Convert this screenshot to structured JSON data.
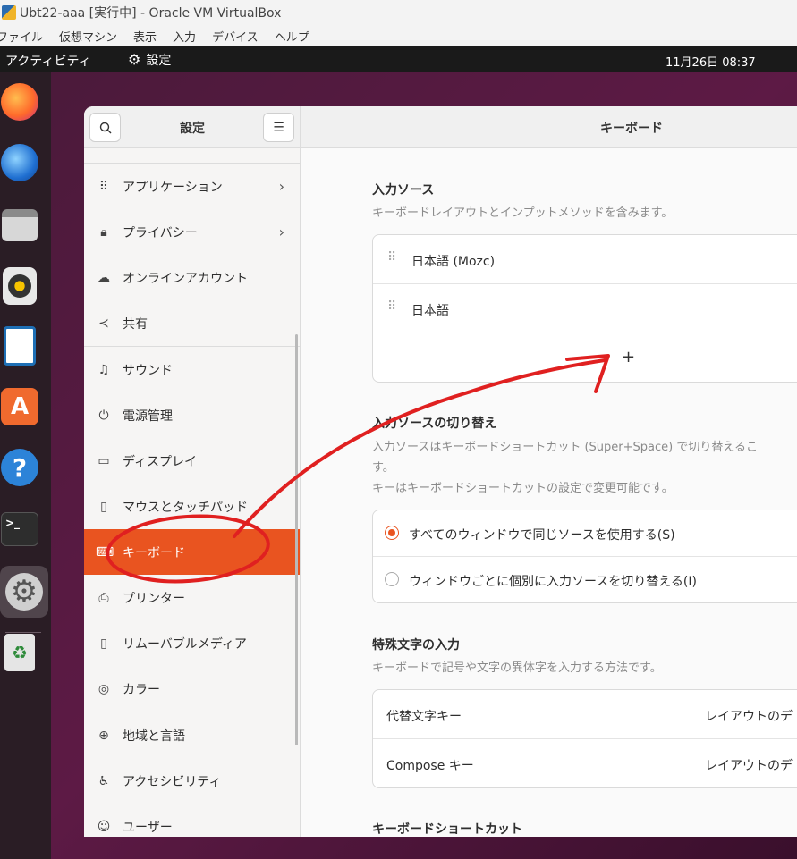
{
  "host": {
    "title": "Ubt22-aaa [実行中] - Oracle VM VirtualBox",
    "menu": [
      "ファイル",
      "仮想マシン",
      "表示",
      "入力",
      "デバイス",
      "ヘルプ"
    ]
  },
  "topbar": {
    "activities": "アクティビティ",
    "app": "設定",
    "clock": "11月26日  08:37"
  },
  "dock": [
    "Firefox",
    "Thunderbird",
    "Files",
    "Rhythmbox",
    "LibreOffice Writer",
    "Ubuntu Software",
    "Help",
    "Terminal",
    "Settings",
    "Trash"
  ],
  "sidebar": {
    "title": "設定",
    "items": [
      {
        "label": "アプリケーション",
        "icon": "apps-icon",
        "chevron": true
      },
      {
        "label": "プライバシー",
        "icon": "lock-icon",
        "chevron": true
      },
      {
        "label": "オンラインアカウント",
        "icon": "cloud-icon",
        "chevron": false
      },
      {
        "label": "共有",
        "icon": "share-icon",
        "chevron": false
      },
      {
        "label": "サウンド",
        "icon": "music-note-icon",
        "chevron": false
      },
      {
        "label": "電源管理",
        "icon": "power-icon",
        "chevron": false
      },
      {
        "label": "ディスプレイ",
        "icon": "display-icon",
        "chevron": false
      },
      {
        "label": "マウスとタッチパッド",
        "icon": "mouse-icon",
        "chevron": false
      },
      {
        "label": "キーボード",
        "icon": "keyboard-icon",
        "chevron": false,
        "selected": true
      },
      {
        "label": "プリンター",
        "icon": "printer-icon",
        "chevron": false
      },
      {
        "label": "リムーバブルメディア",
        "icon": "usb-icon",
        "chevron": false
      },
      {
        "label": "カラー",
        "icon": "color-icon",
        "chevron": false
      },
      {
        "label": "地域と言語",
        "icon": "globe-icon",
        "chevron": false
      },
      {
        "label": "アクセシビリティ",
        "icon": "accessibility-icon",
        "chevron": false
      },
      {
        "label": "ユーザー",
        "icon": "user-icon",
        "chevron": false
      }
    ]
  },
  "main": {
    "title": "キーボード",
    "input_sources": {
      "title": "入力ソース",
      "desc": "キーボードレイアウトとインプットメソッドを含みます。",
      "items": [
        "日本語 (Mozc)",
        "日本語"
      ],
      "add": "+"
    },
    "switching": {
      "title": "入力ソースの切り替え",
      "desc1": "入力ソースはキーボードショートカット (Super+Space) で切り替えるこ",
      "desc2": "す。",
      "desc3": "キーはキーボードショートカットの設定で変更可能です。",
      "options": [
        {
          "label": "すべてのウィンドウで同じソースを使用する(S)",
          "checked": true
        },
        {
          "label": "ウィンドウごとに個別に入力ソースを切り替える(I)",
          "checked": false
        }
      ]
    },
    "special": {
      "title": "特殊文字の入力",
      "desc": "キーボードで記号や文字の異体字を入力する方法です。",
      "rows": [
        {
          "label": "代替文字キー",
          "value": "レイアウトのデ"
        },
        {
          "label": "Compose キー",
          "value": "レイアウトのデ"
        }
      ]
    },
    "shortcuts": {
      "title": "キーボードショートカット"
    }
  },
  "colors": {
    "accent": "#e95420",
    "annotation": "#e02020"
  }
}
